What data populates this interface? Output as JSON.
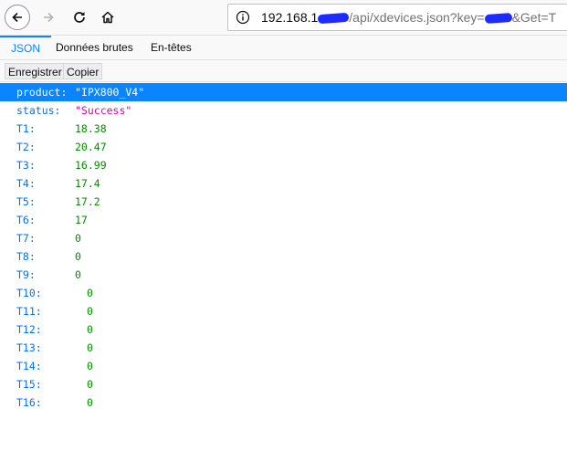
{
  "browser": {
    "url_host": "192.168.1",
    "url_path": "/api/xdevices.json?key=",
    "url_tail": "&Get=T"
  },
  "tabs": [
    {
      "label": "JSON",
      "active": true
    },
    {
      "label": "Données brutes",
      "active": false
    },
    {
      "label": "En-têtes",
      "active": false
    }
  ],
  "actions": {
    "save_label": "Enregistrer",
    "copy_label": "Copier"
  },
  "json_rows": [
    {
      "key": "product:",
      "value": "\"IPX800_V4\"",
      "type": "string",
      "selected": true
    },
    {
      "key": "status:",
      "value": "\"Success\"",
      "type": "string",
      "selected": false
    },
    {
      "key": "T1:",
      "value": "18.38",
      "type": "number",
      "selected": false
    },
    {
      "key": "T2:",
      "value": "20.47",
      "type": "number",
      "selected": false
    },
    {
      "key": "T3:",
      "value": "16.99",
      "type": "number",
      "selected": false
    },
    {
      "key": "T4:",
      "value": "17.4",
      "type": "number",
      "selected": false
    },
    {
      "key": "T5:",
      "value": "17.2",
      "type": "number",
      "selected": false
    },
    {
      "key": "T6:",
      "value": "17",
      "type": "number",
      "selected": false
    },
    {
      "key": "T7:",
      "value": "0",
      "type": "number",
      "selected": false
    },
    {
      "key": "T8:",
      "value": "0",
      "type": "number",
      "selected": false
    },
    {
      "key": "T9:",
      "value": "0",
      "type": "number",
      "selected": false
    },
    {
      "key": "T10:",
      "value": "0",
      "type": "number",
      "selected": false
    },
    {
      "key": "T11:",
      "value": "0",
      "type": "number",
      "selected": false
    },
    {
      "key": "T12:",
      "value": "0",
      "type": "number",
      "selected": false
    },
    {
      "key": "T13:",
      "value": "0",
      "type": "number",
      "selected": false
    },
    {
      "key": "T14:",
      "value": "0",
      "type": "number",
      "selected": false
    },
    {
      "key": "T15:",
      "value": "0",
      "type": "number",
      "selected": false
    },
    {
      "key": "T16:",
      "value": "0",
      "type": "number",
      "selected": false
    }
  ],
  "colors": {
    "accent": "#0a84ff",
    "key": "#0074e8",
    "number": "#058b00",
    "string": "#dd00a9"
  }
}
